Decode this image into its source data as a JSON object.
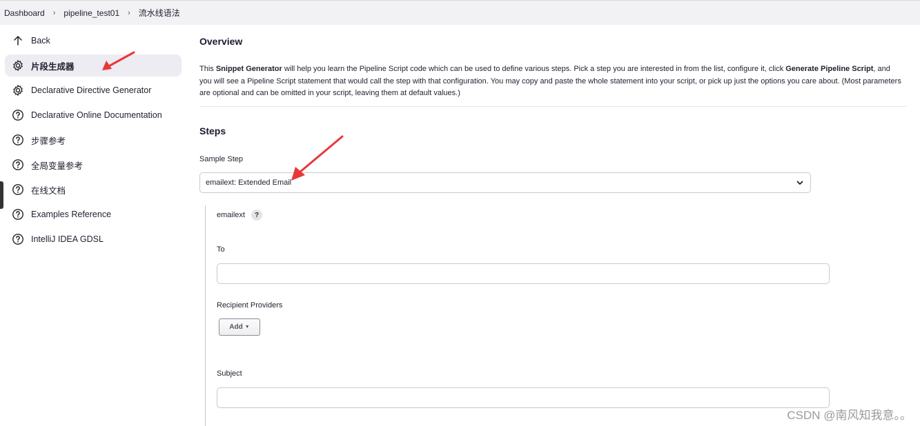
{
  "breadcrumb": {
    "items": [
      "Dashboard",
      "pipeline_test01",
      "流水线语法"
    ]
  },
  "sidebar": {
    "items": [
      {
        "label": "Back",
        "icon": "arrow-up-icon"
      },
      {
        "label": "片段生成器",
        "icon": "gear-icon",
        "active": true
      },
      {
        "label": "Declarative Directive Generator",
        "icon": "gear-icon"
      },
      {
        "label": "Declarative Online Documentation",
        "icon": "help-circle-icon"
      },
      {
        "label": "步骤参考",
        "icon": "help-circle-icon"
      },
      {
        "label": "全局变量参考",
        "icon": "help-circle-icon"
      },
      {
        "label": "在线文档",
        "icon": "help-circle-icon"
      },
      {
        "label": "Examples Reference",
        "icon": "help-circle-icon"
      },
      {
        "label": "IntelliJ IDEA GDSL",
        "icon": "help-circle-icon"
      }
    ]
  },
  "overview": {
    "title": "Overview",
    "text_1": "This ",
    "bold_1": "Snippet Generator",
    "text_2": " will help you learn the Pipeline Script code which can be used to define various steps. Pick a step you are interested in from the list, configure it, click ",
    "bold_2": "Generate Pipeline Script",
    "text_3": ", and you will see a Pipeline Script statement that would call the step with that configuration. You may copy and paste the whole statement into your script, or pick up just the options you care about. (Most parameters are optional and can be omitted in your script, leaving them at default values.)"
  },
  "steps": {
    "title": "Steps",
    "sample_step_label": "Sample Step",
    "sample_step_value": "emailext: Extended Email",
    "step_name": "emailext",
    "help_badge": "?",
    "to_label": "To",
    "to_value": "",
    "recipient_providers_label": "Recipient Providers",
    "add_button": "Add",
    "subject_label": "Subject",
    "subject_value": ""
  },
  "watermark": "CSDN @南风知我意。。",
  "colors": {
    "annotation_arrow": "#e8373a",
    "active_bg": "#ececf2",
    "topbar_bg": "#f2f2f5"
  }
}
